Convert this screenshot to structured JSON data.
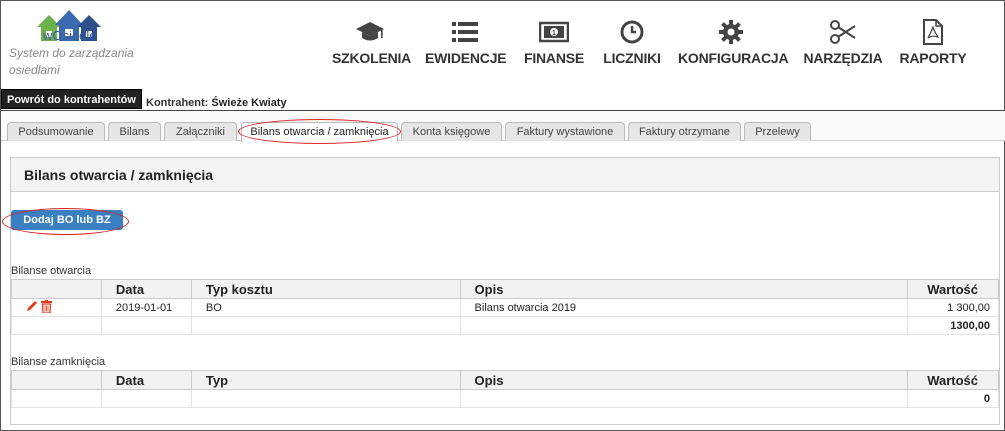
{
  "brand": {
    "logo_text": "wOsiedle",
    "tagline": "System do zarządzania osiedlami"
  },
  "nav": [
    {
      "label": "SZKOLENIA",
      "icon": "graduation-cap-icon"
    },
    {
      "label": "EWIDENCJE",
      "icon": "list-icon"
    },
    {
      "label": "FINANSE",
      "icon": "money-icon"
    },
    {
      "label": "LICZNIKI",
      "icon": "clock-icon"
    },
    {
      "label": "KONFIGURACJA",
      "icon": "gear-icon"
    },
    {
      "label": "NARZĘDZIA",
      "icon": "scissors-icon"
    },
    {
      "label": "RAPORTY",
      "icon": "pdf-file-icon"
    }
  ],
  "back_button": "Powrót do kontrahentów",
  "contractor": {
    "label": "Kontrahent:",
    "value": "Świeże Kwiaty"
  },
  "tabs": [
    {
      "label": "Podsumowanie"
    },
    {
      "label": "Bilans"
    },
    {
      "label": "Załączniki"
    },
    {
      "label": "Bilans otwarcia / zamknięcia"
    },
    {
      "label": "Konta księgowe"
    },
    {
      "label": "Faktury wystawione"
    },
    {
      "label": "Faktury otrzymane"
    },
    {
      "label": "Przelewy"
    }
  ],
  "active_tab": "Bilans otwarcia / zamknięcia",
  "panel_title": "Bilans otwarcia / zamknięcia",
  "add_button": "Dodaj BO lub BZ",
  "opening": {
    "label": "Bilanse otwarcia",
    "columns": [
      "Data",
      "Typ kosztu",
      "Opis",
      "Wartość"
    ],
    "rows": [
      {
        "date": "2019-01-01",
        "type": "BO",
        "desc": "Bilans otwarcia 2019",
        "value": "1 300,00"
      }
    ],
    "total": "1300,00"
  },
  "closing": {
    "label": "Bilanse zamknięcia",
    "columns": [
      "Data",
      "Typ",
      "Opis",
      "Wartość"
    ],
    "total": "0"
  },
  "colors": {
    "accent_button": "#3a7fc1",
    "annotation": "#d22222",
    "edit_icon": "#e03a1e",
    "delete_icon": "#e03a1e"
  }
}
